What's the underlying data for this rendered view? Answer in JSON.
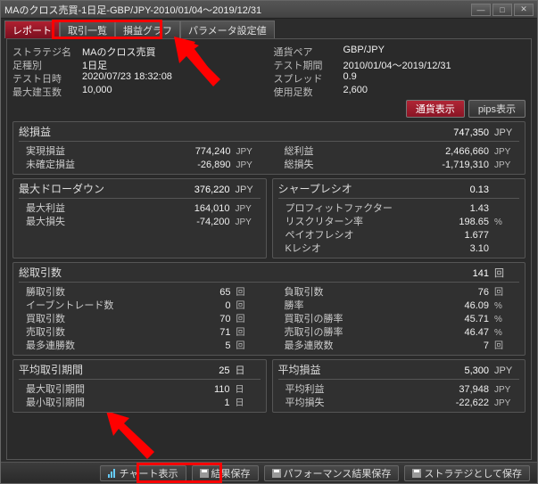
{
  "window": {
    "title": "MAのクロス売買-1日足-GBP/JPY-2010/01/04～2019/12/31"
  },
  "tabs": [
    {
      "label": "レポート",
      "active": true
    },
    {
      "label": "取引一覧",
      "active": false
    },
    {
      "label": "損益グラフ",
      "active": false
    },
    {
      "label": "パラメータ設定値",
      "active": false
    }
  ],
  "info_left": [
    {
      "k": "ストラテジ名",
      "v": "MAのクロス売買"
    },
    {
      "k": "足種別",
      "v": "1日足"
    },
    {
      "k": "テスト日時",
      "v": "2020/07/23 18:32:08"
    },
    {
      "k": "最大建玉数",
      "v": "10,000"
    }
  ],
  "info_right": [
    {
      "k": "通貨ペア",
      "v": "GBP/JPY"
    },
    {
      "k": "テスト期間",
      "v": "2010/01/04～2019/12/31"
    },
    {
      "k": "スプレッド",
      "v": "0.9"
    },
    {
      "k": "使用足数",
      "v": "2,600"
    }
  ],
  "toggle": {
    "a": "通貨表示",
    "b": "pips表示"
  },
  "section_soueki": {
    "title": "総損益",
    "val": "747,350",
    "unit": "JPY",
    "left": [
      {
        "l": "実現損益",
        "v": "774,240",
        "u": "JPY"
      },
      {
        "l": "未確定損益",
        "v": "-26,890",
        "u": "JPY"
      }
    ],
    "right": [
      {
        "l": "総利益",
        "v": "2,466,660",
        "u": "JPY"
      },
      {
        "l": "総損失",
        "v": "-1,719,310",
        "u": "JPY"
      }
    ]
  },
  "section_dd": {
    "title": "最大ドローダウン",
    "val": "376,220",
    "unit": "JPY",
    "rows": [
      {
        "l": "最大利益",
        "v": "164,010",
        "u": "JPY"
      },
      {
        "l": "最大損失",
        "v": "-74,200",
        "u": "JPY"
      }
    ]
  },
  "section_sharpe": {
    "title": "シャープレシオ",
    "val": "0.13",
    "unit": "",
    "rows": [
      {
        "l": "プロフィットファクター",
        "v": "1.43",
        "u": ""
      },
      {
        "l": "リスクリターン率",
        "v": "198.65",
        "u": "%"
      },
      {
        "l": "ペイオフレシオ",
        "v": "1.677",
        "u": ""
      },
      {
        "l": "Kレシオ",
        "v": "3.10",
        "u": ""
      }
    ]
  },
  "section_count": {
    "title": "総取引数",
    "val": "141",
    "unit": "回",
    "left": [
      {
        "l": "勝取引数",
        "v": "65",
        "u": "回"
      },
      {
        "l": "イーブントレード数",
        "v": "0",
        "u": "回"
      },
      {
        "l": "買取引数",
        "v": "70",
        "u": "回"
      },
      {
        "l": "売取引数",
        "v": "71",
        "u": "回"
      },
      {
        "l": "最多連勝数",
        "v": "5",
        "u": "回"
      }
    ],
    "right": [
      {
        "l": "負取引数",
        "v": "76",
        "u": "回"
      },
      {
        "l": "勝率",
        "v": "46.09",
        "u": "%"
      },
      {
        "l": "買取引の勝率",
        "v": "45.71",
        "u": "%"
      },
      {
        "l": "売取引の勝率",
        "v": "46.47",
        "u": "%"
      },
      {
        "l": "最多連敗数",
        "v": "7",
        "u": "回"
      }
    ]
  },
  "section_period": {
    "title": "平均取引期間",
    "val": "25",
    "unit": "日",
    "rows": [
      {
        "l": "最大取引期間",
        "v": "110",
        "u": "日"
      },
      {
        "l": "最小取引期間",
        "v": "1",
        "u": "日"
      }
    ]
  },
  "section_avg": {
    "title": "平均損益",
    "val": "5,300",
    "unit": "JPY",
    "rows": [
      {
        "l": "平均利益",
        "v": "37,948",
        "u": "JPY"
      },
      {
        "l": "平均損失",
        "v": "-22,622",
        "u": "JPY"
      }
    ]
  },
  "bottom": {
    "chart": "チャート表示",
    "save": "結果保存",
    "perf": "パフォーマンス結果保存",
    "strategy": "ストラテジとして保存"
  }
}
